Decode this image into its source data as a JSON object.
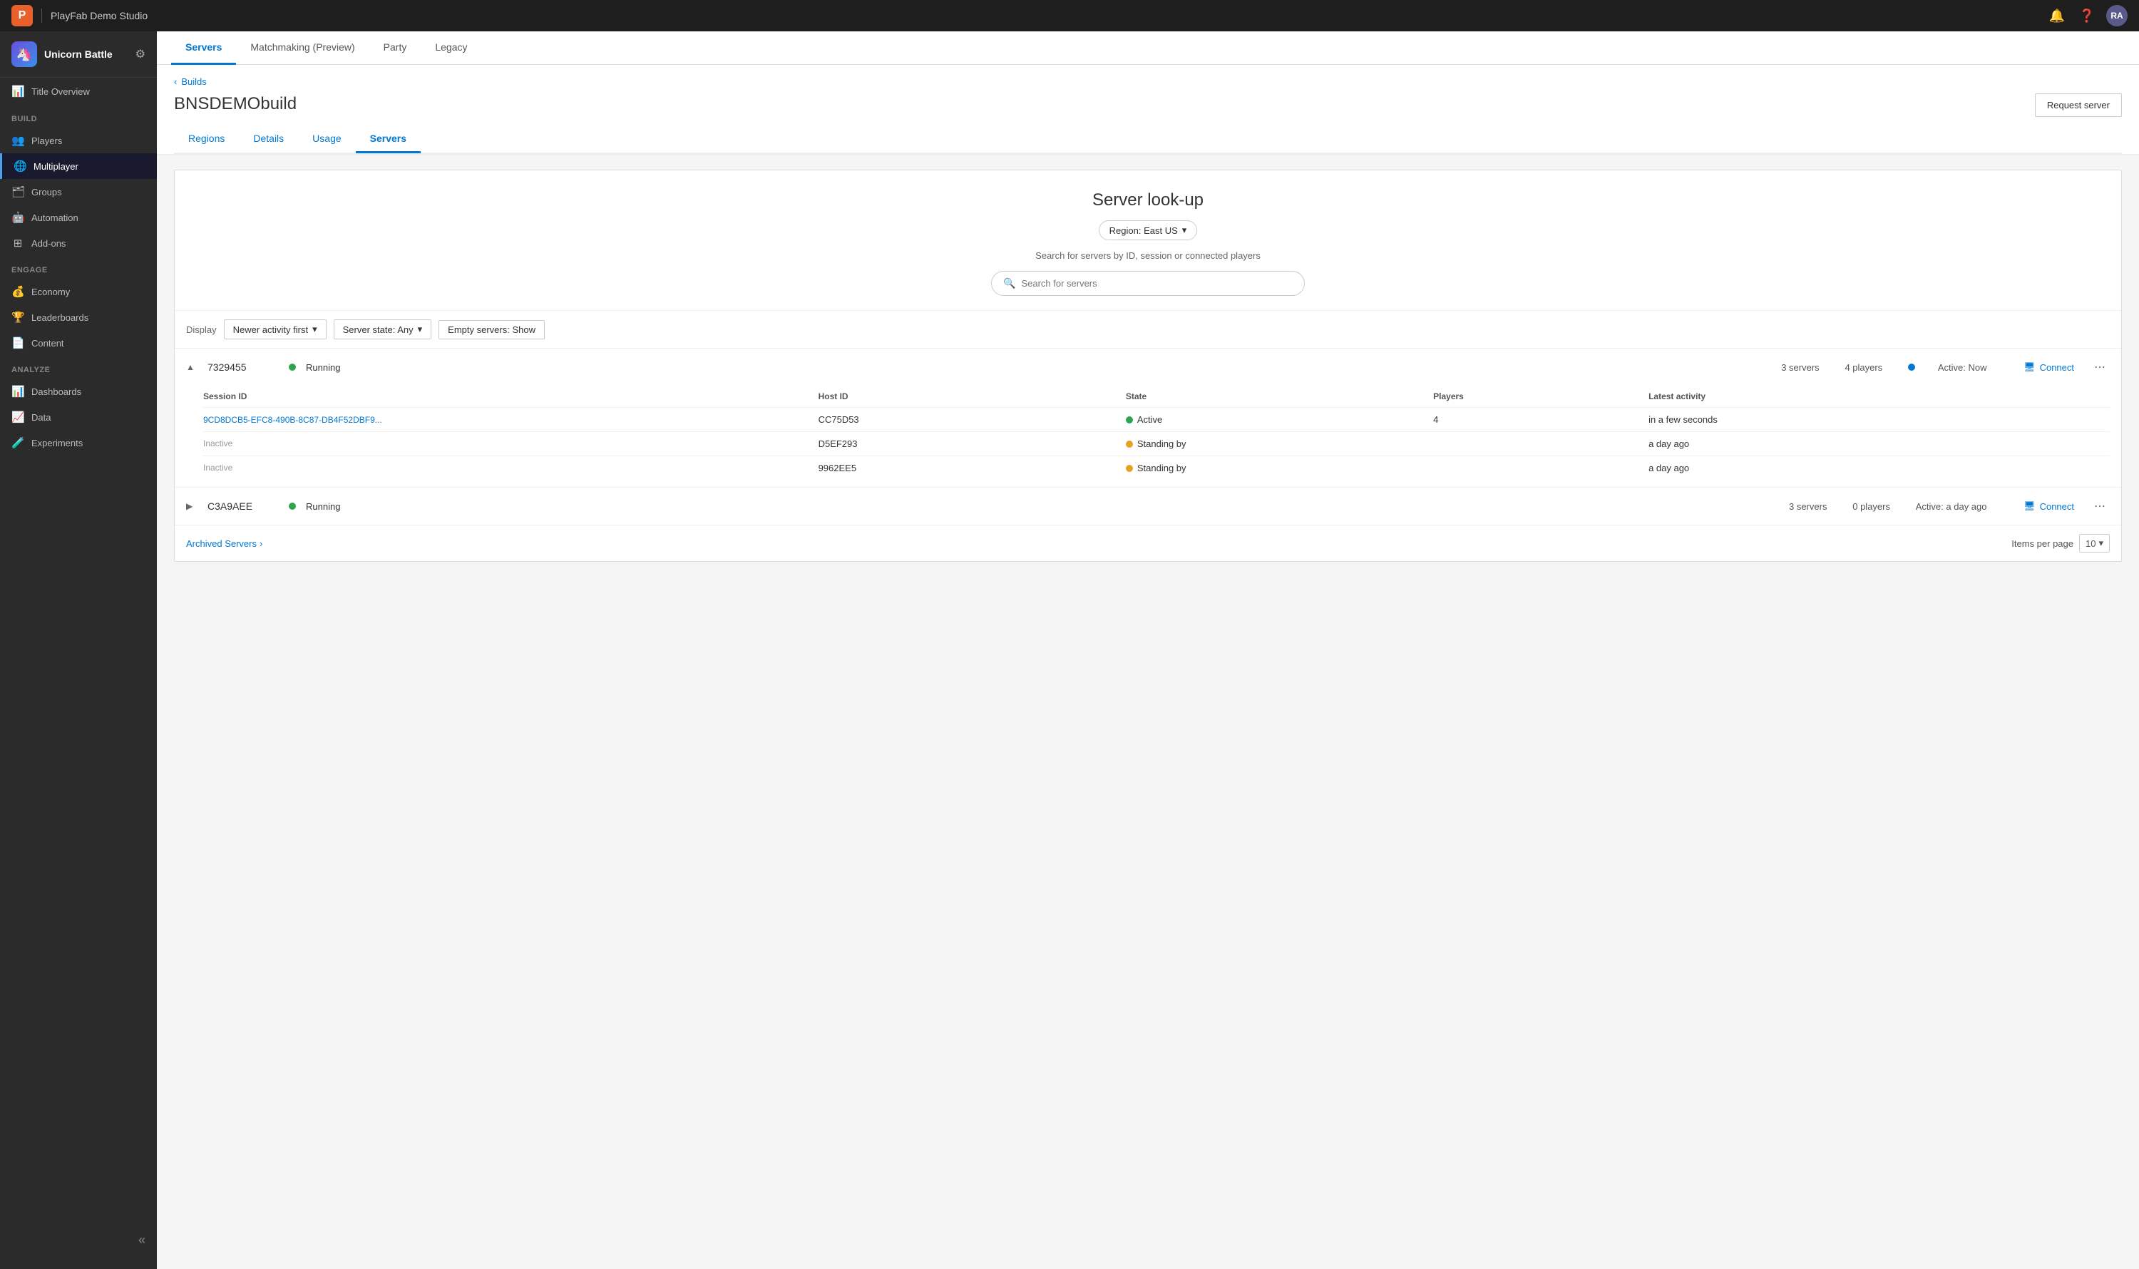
{
  "topbar": {
    "logo_text": "P",
    "title": "PlayFab Demo Studio",
    "avatar_text": "RA"
  },
  "sidebar": {
    "game_title": "Unicorn Battle",
    "sections": {
      "title_overview": "Title Overview",
      "build_label": "BUILD",
      "build_items": [
        {
          "label": "Players",
          "icon": "👥",
          "id": "players"
        },
        {
          "label": "Multiplayer",
          "icon": "🌐",
          "id": "multiplayer",
          "active": true
        },
        {
          "label": "Groups",
          "icon": "🗂",
          "id": "groups"
        },
        {
          "label": "Automation",
          "icon": "🤖",
          "id": "automation"
        },
        {
          "label": "Add-ons",
          "icon": "⊞",
          "id": "addons"
        }
      ],
      "engage_label": "ENGAGE",
      "engage_items": [
        {
          "label": "Economy",
          "icon": "💰",
          "id": "economy"
        },
        {
          "label": "Leaderboards",
          "icon": "🏆",
          "id": "leaderboards"
        },
        {
          "label": "Content",
          "icon": "📄",
          "id": "content"
        }
      ],
      "analyze_label": "ANALYZE",
      "analyze_items": [
        {
          "label": "Dashboards",
          "icon": "📊",
          "id": "dashboards"
        },
        {
          "label": "Data",
          "icon": "📈",
          "id": "data"
        },
        {
          "label": "Experiments",
          "icon": "🧪",
          "id": "experiments"
        }
      ]
    }
  },
  "main_tabs": [
    {
      "label": "Servers",
      "id": "servers",
      "active": true
    },
    {
      "label": "Matchmaking (Preview)",
      "id": "matchmaking"
    },
    {
      "label": "Party",
      "id": "party"
    },
    {
      "label": "Legacy",
      "id": "legacy"
    }
  ],
  "breadcrumb": "Builds",
  "build_name": "BNSDEMObuild",
  "request_server_btn": "Request server",
  "build_tabs": [
    {
      "label": "Regions",
      "id": "regions"
    },
    {
      "label": "Details",
      "id": "details"
    },
    {
      "label": "Usage",
      "id": "usage"
    },
    {
      "label": "Servers",
      "id": "servers-tab",
      "active": true
    }
  ],
  "server_lookup": {
    "title": "Server look-up",
    "region_label": "Region: East US",
    "desc": "Search for servers by ID, session or connected players",
    "search_placeholder": "Search for servers"
  },
  "display_label": "Display",
  "filters": {
    "activity": "Newer activity first",
    "state": "Server state: Any",
    "empty": "Empty servers: Show"
  },
  "servers": [
    {
      "id": "7329455",
      "status": "Running",
      "status_color": "green",
      "servers_count": "3 servers",
      "players_count": "4 players",
      "active_label": "Active: Now",
      "active_color": "blue",
      "expanded": true,
      "sessions": [
        {
          "session_id": "9CD8DCB5-EFC8-490B-8C87-DB4F52DBF9...",
          "is_link": true,
          "host_id": "CC75D53",
          "state": "Active",
          "state_color": "green",
          "players": "4",
          "latest_activity": "in a few seconds"
        },
        {
          "session_id": "Inactive",
          "is_link": false,
          "host_id": "D5EF293",
          "state": "Standing by",
          "state_color": "orange",
          "players": "",
          "latest_activity": "a day ago"
        },
        {
          "session_id": "Inactive",
          "is_link": false,
          "host_id": "9962EE5",
          "state": "Standing by",
          "state_color": "orange",
          "players": "",
          "latest_activity": "a day ago"
        }
      ]
    },
    {
      "id": "C3A9AEE",
      "status": "Running",
      "status_color": "green",
      "servers_count": "3 servers",
      "players_count": "0 players",
      "active_label": "Active: a day ago",
      "active_color": "none",
      "expanded": false,
      "sessions": []
    }
  ],
  "footer": {
    "archived_label": "Archived Servers",
    "items_per_page_label": "Items per page",
    "items_per_page_value": "10"
  },
  "sub_table_headers": {
    "session_id": "Session ID",
    "host_id": "Host ID",
    "state": "State",
    "players": "Players",
    "latest_activity": "Latest activity"
  },
  "connect_label": "Connect",
  "collapse_icon": "«"
}
